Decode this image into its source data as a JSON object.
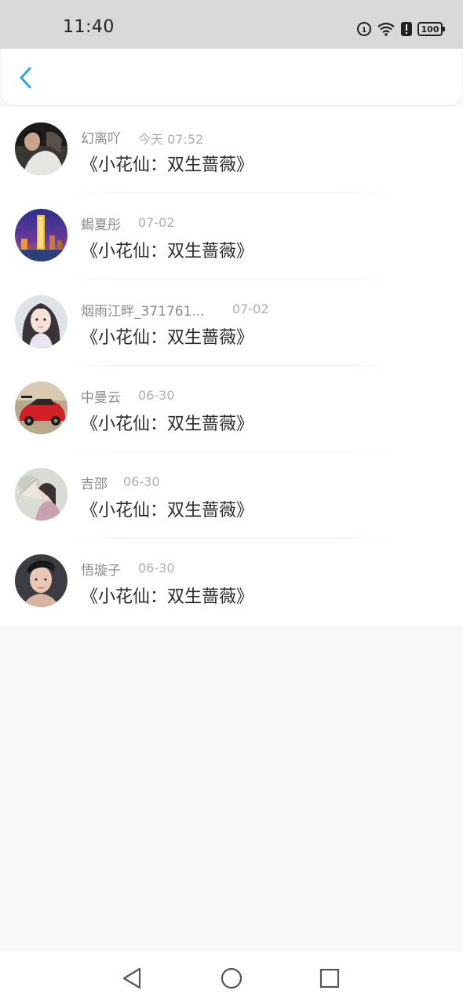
{
  "status_bar": {
    "time": "11:40",
    "battery": "100",
    "icons": [
      "data-saver-icon",
      "wifi-icon",
      "alert-icon",
      "battery-icon"
    ]
  },
  "header": {
    "back_icon": "chevron-left-icon",
    "accent_color": "#2ea7e0"
  },
  "list": {
    "items": [
      {
        "name": "幻离吖",
        "time": "今天 07:52",
        "title": "《小花仙：双生蔷薇》",
        "avatar": "avatar-dark-photo"
      },
      {
        "name": "蝎夏彤",
        "time": "07-02",
        "title": "《小花仙：双生蔷薇》",
        "avatar": "avatar-night-city"
      },
      {
        "name": "烟雨江畔_371761...",
        "time": "07-02",
        "title": "《小花仙：双生蔷薇》",
        "avatar": "avatar-illustrated-girl"
      },
      {
        "name": "中曼云",
        "time": "06-30",
        "title": "《小花仙：双生蔷薇》",
        "avatar": "avatar-red-car"
      },
      {
        "name": "吉邵",
        "time": "06-30",
        "title": "《小花仙：双生蔷薇》",
        "avatar": "avatar-girl-fan"
      },
      {
        "name": "悟璇子",
        "time": "06-30",
        "title": "《小花仙：双生蔷薇》",
        "avatar": "avatar-young-man"
      }
    ]
  },
  "nav_bar": {
    "icons": [
      "back-triangle-icon",
      "home-circle-icon",
      "recents-square-icon"
    ]
  }
}
